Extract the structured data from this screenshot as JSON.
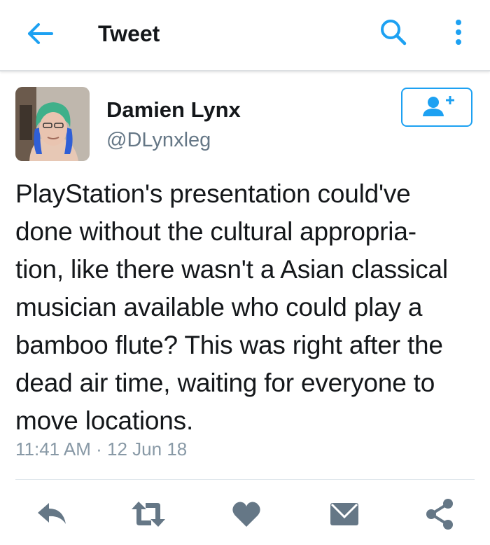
{
  "header": {
    "title": "Tweet",
    "back_icon": "arrow-left-icon",
    "search_icon": "search-icon",
    "more_icon": "more-vertical-icon",
    "accent_color": "#1da1f2"
  },
  "tweet": {
    "author": {
      "name": "Damien Lynx",
      "handle": "@DLynxleg",
      "follow_icon": "add-user-icon"
    },
    "text_lines": [
      "PlayStation's presentation could've",
      "done without the cultural appropria-",
      "tion, like there wasn't a Asian classical",
      "musician available who could play a",
      "bamboo flute? This was right after the",
      "dead air time, waiting for everyone to",
      "move locations."
    ],
    "timestamp": "11:41 AM · 12 Jun 18"
  },
  "actions": [
    {
      "icon": "reply-icon"
    },
    {
      "icon": "retweet-icon"
    },
    {
      "icon": "heart-icon"
    },
    {
      "icon": "direct-message-icon"
    },
    {
      "icon": "share-icon"
    }
  ],
  "icon_color": "#657786"
}
